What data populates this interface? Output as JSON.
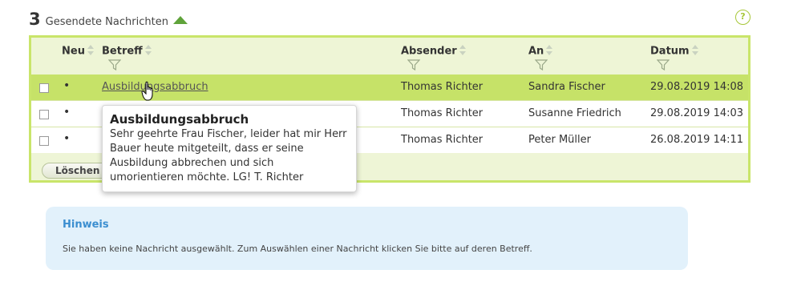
{
  "header": {
    "count": "3",
    "title": "Gesendete Nachrichten"
  },
  "table": {
    "columns": {
      "neu": "Neu",
      "betreff": "Betreff",
      "absender": "Absender",
      "an": "An",
      "datum": "Datum"
    },
    "rows": [
      {
        "bullet": "•",
        "subject": "Ausbildungsabbruch",
        "sender": "Thomas Richter",
        "recipient": "Sandra Fischer",
        "date": "29.08.2019 14:08"
      },
      {
        "bullet": "•",
        "subject": "",
        "sender": "Thomas Richter",
        "recipient": "Susanne Friedrich",
        "date": "29.08.2019 14:03"
      },
      {
        "bullet": "•",
        "subject": "",
        "sender": "Thomas Richter",
        "recipient": "Peter Müller",
        "date": "26.08.2019 14:11"
      }
    ],
    "delete_label": "Löschen"
  },
  "tooltip": {
    "title": "Ausbildungsabbruch",
    "body": "Sehr geehrte Frau Fischer, leider hat mir Herr Bauer heute mitgeteilt, dass er seine Ausbildung abbrechen und sich umorientieren möchte. LG! T. Richter"
  },
  "notice": {
    "title": "Hinweis",
    "text": "Sie haben keine Nachricht ausgewählt. Zum Auswählen einer Nachricht klicken Sie bitte auf deren Betreff."
  },
  "help_label": "?",
  "colors": {
    "accent_green": "#c9e56a",
    "selected_row": "#c6e268",
    "notice_bg": "#e2f1fb",
    "notice_title": "#3b8ed0"
  }
}
